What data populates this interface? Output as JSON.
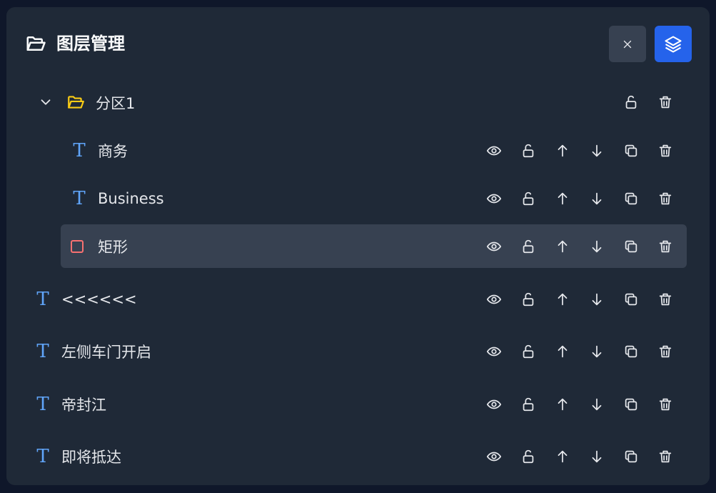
{
  "header": {
    "title": "图层管理",
    "title_icon": "folder-open-icon",
    "close_icon": "close-icon",
    "layers_icon": "layers-icon"
  },
  "colors": {
    "panel_bg": "#1f2937",
    "primary_button": "#2563eb",
    "text_icon": "#60a5fa",
    "rect_icon": "#f87171",
    "folder_icon": "#facc15",
    "selected_row": "#374151"
  },
  "group": {
    "label": "分区1",
    "expanded": true,
    "children": [
      {
        "label": "商务",
        "type": "text"
      },
      {
        "label": "Business",
        "type": "text"
      },
      {
        "label": "矩形",
        "type": "rect",
        "selected": true
      }
    ]
  },
  "layers": [
    {
      "label": "<<<<<<",
      "type": "text"
    },
    {
      "label": "左侧车门开启",
      "type": "text"
    },
    {
      "label": "帝封江",
      "type": "text"
    },
    {
      "label": "即将抵达",
      "type": "text"
    }
  ],
  "text_glyph": "T"
}
